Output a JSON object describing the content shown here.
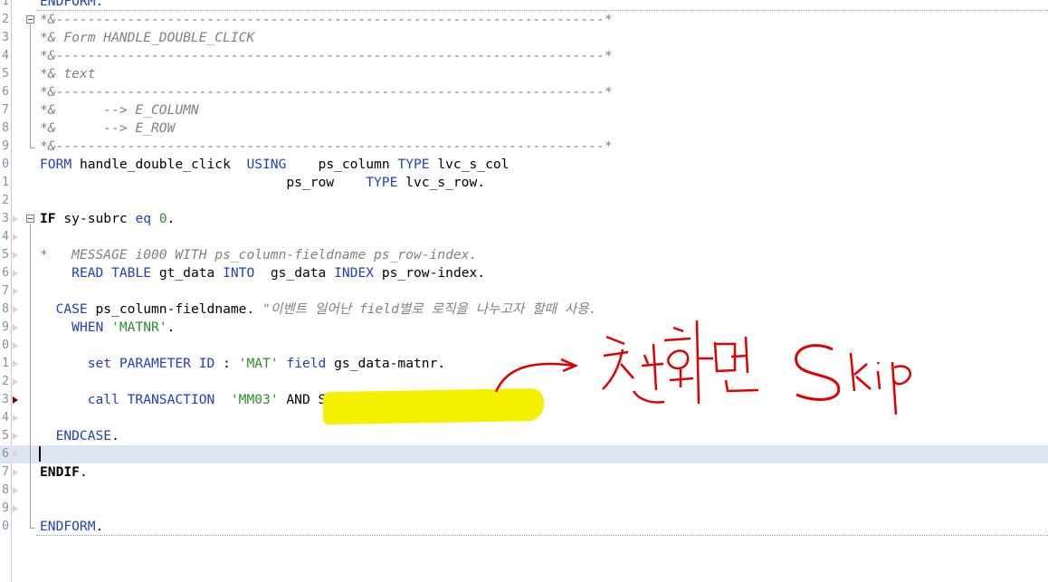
{
  "editor": {
    "language": "ABAP",
    "lines": [
      {
        "no": "1",
        "segments": [
          {
            "t": "ENDFORM.",
            "c": "kw"
          }
        ]
      },
      {
        "no": "2",
        "segments": [
          {
            "t": "*&---------------------------------------------------------------------*",
            "c": "cmt"
          }
        ]
      },
      {
        "no": "3",
        "segments": [
          {
            "t": "*& Form HANDLE_DOUBLE_CLICK",
            "c": "cmt"
          }
        ]
      },
      {
        "no": "4",
        "segments": [
          {
            "t": "*&---------------------------------------------------------------------*",
            "c": "cmt"
          }
        ]
      },
      {
        "no": "5",
        "segments": [
          {
            "t": "*& text",
            "c": "cmt"
          }
        ]
      },
      {
        "no": "6",
        "segments": [
          {
            "t": "*&---------------------------------------------------------------------*",
            "c": "cmt"
          }
        ]
      },
      {
        "no": "7",
        "segments": [
          {
            "t": "*&      --> E_COLUMN",
            "c": "cmt"
          }
        ]
      },
      {
        "no": "8",
        "segments": [
          {
            "t": "*&      --> E_ROW",
            "c": "cmt"
          }
        ]
      },
      {
        "no": "9",
        "segments": [
          {
            "t": "*&---------------------------------------------------------------------*",
            "c": "cmt"
          }
        ]
      },
      {
        "no": "0",
        "segments": [
          {
            "t": "FORM",
            "c": "kw"
          },
          {
            "t": " handle_double_click  ",
            "c": ""
          },
          {
            "t": "USING",
            "c": "kw"
          },
          {
            "t": "    ps_column ",
            "c": ""
          },
          {
            "t": "TYPE",
            "c": "kw"
          },
          {
            "t": " lvc_s_col",
            "c": ""
          }
        ]
      },
      {
        "no": "1",
        "segments": [
          {
            "t": "                               ps_row    ",
            "c": ""
          },
          {
            "t": "TYPE",
            "c": "kw"
          },
          {
            "t": " lvc_s_row.",
            "c": ""
          }
        ]
      },
      {
        "no": "2",
        "segments": []
      },
      {
        "no": "3",
        "segments": [
          {
            "t": "IF",
            "c": "bold"
          },
          {
            "t": " sy-subrc ",
            "c": ""
          },
          {
            "t": "eq",
            "c": "kw"
          },
          {
            "t": " ",
            "c": ""
          },
          {
            "t": "0",
            "c": "num"
          },
          {
            "t": ".",
            "c": ""
          }
        ]
      },
      {
        "no": "4",
        "segments": []
      },
      {
        "no": "5",
        "segments": [
          {
            "t": "*   MESSAGE i000 WITH ps_column-fieldname ps_row-index.",
            "c": "cmt"
          }
        ]
      },
      {
        "no": "6",
        "segments": [
          {
            "t": "    ",
            "c": ""
          },
          {
            "t": "READ TABLE",
            "c": "kw"
          },
          {
            "t": " gt_data ",
            "c": ""
          },
          {
            "t": "INTO",
            "c": "kw"
          },
          {
            "t": "  gs_data ",
            "c": ""
          },
          {
            "t": "INDEX",
            "c": "kw"
          },
          {
            "t": " ps_row-index.",
            "c": ""
          }
        ]
      },
      {
        "no": "7",
        "segments": []
      },
      {
        "no": "8",
        "segments": [
          {
            "t": "  ",
            "c": ""
          },
          {
            "t": "CASE",
            "c": "kw"
          },
          {
            "t": " ps_column-fieldname. ",
            "c": ""
          },
          {
            "t": "\"이벤트 일어난 field별로 로직을 나누고자 할때 사용.",
            "c": "cmt"
          }
        ]
      },
      {
        "no": "9",
        "segments": [
          {
            "t": "    ",
            "c": ""
          },
          {
            "t": "WHEN",
            "c": "kw"
          },
          {
            "t": " ",
            "c": ""
          },
          {
            "t": "'MATNR'",
            "c": "str"
          },
          {
            "t": ".",
            "c": ""
          }
        ]
      },
      {
        "no": "0",
        "segments": []
      },
      {
        "no": "1",
        "segments": [
          {
            "t": "      ",
            "c": ""
          },
          {
            "t": "set PARAMETER ID",
            "c": "kw"
          },
          {
            "t": " : ",
            "c": ""
          },
          {
            "t": "'MAT'",
            "c": "str"
          },
          {
            "t": " ",
            "c": ""
          },
          {
            "t": "field",
            "c": "kw"
          },
          {
            "t": " gs_data-matnr.",
            "c": ""
          }
        ]
      },
      {
        "no": "2",
        "segments": []
      },
      {
        "no": "3",
        "segments": [
          {
            "t": "      ",
            "c": ""
          },
          {
            "t": "call TRANSACTION",
            "c": "kw"
          },
          {
            "t": "  ",
            "c": ""
          },
          {
            "t": "'MM03'",
            "c": "str"
          },
          {
            "t": " AND SKIP FIRST SCREEN.",
            "c": ""
          }
        ]
      },
      {
        "no": "4",
        "segments": []
      },
      {
        "no": "5",
        "segments": [
          {
            "t": "  ",
            "c": ""
          },
          {
            "t": "ENDCASE",
            "c": "kw"
          },
          {
            "t": ".",
            "c": ""
          }
        ]
      },
      {
        "no": "6",
        "segments": []
      },
      {
        "no": "7",
        "segments": [
          {
            "t": "ENDIF",
            "c": "bold"
          },
          {
            "t": ".",
            "c": ""
          }
        ]
      },
      {
        "no": "8",
        "segments": []
      },
      {
        "no": "9",
        "segments": []
      },
      {
        "no": "0",
        "segments": [
          {
            "t": "ENDFORM",
            "c": "kw"
          },
          {
            "t": ".",
            "c": ""
          }
        ]
      }
    ]
  },
  "annotation": {
    "handwritten_text": "첫화면 skip",
    "color": "#e00000"
  },
  "colors": {
    "keyword": "#1f3fbf",
    "string": "#2f8f2f",
    "comment": "#808080",
    "current_line": "#dce6f2",
    "highlight": "#f5f000"
  }
}
